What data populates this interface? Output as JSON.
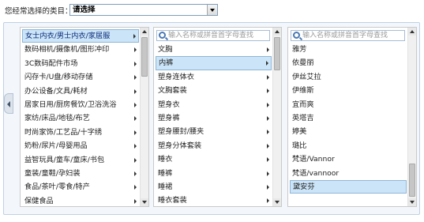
{
  "header": {
    "label": "您经常选择的类目：",
    "select_value": "请选择"
  },
  "colors": {
    "selected_bg": "#cbe4f7",
    "selected_border": "#8fb6d6",
    "frame_bg": "#f3f7fb"
  },
  "column1": {
    "items": [
      {
        "label": "女士内衣/男士内衣/家居服",
        "selected": true
      },
      {
        "label": "数码相机/摄像机/图形冲印"
      },
      {
        "label": "3C数码配件市场"
      },
      {
        "label": "闪存卡/U盘/移动存储"
      },
      {
        "label": "办公设备/文具/耗材"
      },
      {
        "label": "居家日用/厨房餐饮/卫浴洗浴"
      },
      {
        "label": "家纺/床品/地毯/布艺"
      },
      {
        "label": "时尚家饰/工艺品/十字绣"
      },
      {
        "label": "奶粉/尿片/母婴用品"
      },
      {
        "label": "益智玩具/童车/童床/书包"
      },
      {
        "label": "童装/童鞋/孕妇装"
      },
      {
        "label": "食品/茶叶/零食/特产"
      },
      {
        "label": "保健食品"
      }
    ]
  },
  "column2": {
    "search_placeholder": "输入名称或拼音首字母查找",
    "items": [
      {
        "label": "文胸"
      },
      {
        "label": "内裤",
        "selected": true
      },
      {
        "label": "塑身连体衣"
      },
      {
        "label": "文胸套装"
      },
      {
        "label": "塑身衣"
      },
      {
        "label": "塑身裤"
      },
      {
        "label": "塑身腰封/腰夹"
      },
      {
        "label": "塑身分体套装"
      },
      {
        "label": "睡衣"
      },
      {
        "label": "睡裤"
      },
      {
        "label": "睡裙"
      },
      {
        "label": "睡衣套装"
      }
    ]
  },
  "column3": {
    "search_placeholder": "输入名称或拼音首字母查找",
    "items": [
      {
        "label": "雅芳"
      },
      {
        "label": "依曼丽"
      },
      {
        "label": "伊丝艾拉"
      },
      {
        "label": "伊维斯"
      },
      {
        "label": "宜而爽"
      },
      {
        "label": "英塔吉"
      },
      {
        "label": "婷美"
      },
      {
        "label": "璐比"
      },
      {
        "label": "梵语/Vannor"
      },
      {
        "label": "梵语/vannoor"
      },
      {
        "label": "黛安芬",
        "selected": true
      }
    ]
  }
}
